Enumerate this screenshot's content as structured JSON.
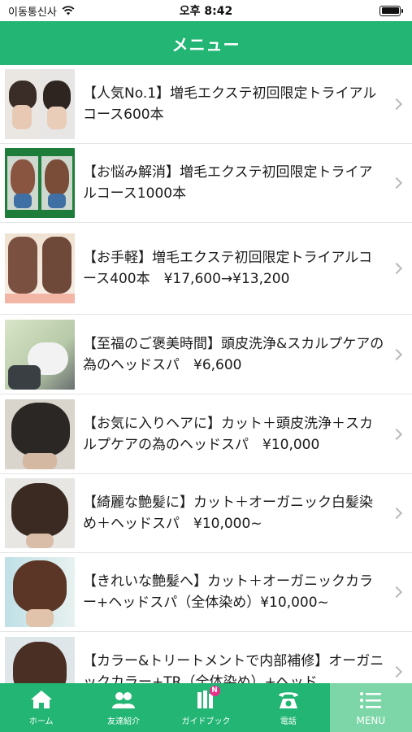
{
  "status": {
    "carrier": "이동통신사",
    "time": "오후 8:42"
  },
  "nav": {
    "title": "メニュー"
  },
  "menu": {
    "items": [
      {
        "text": "【人気No.1】増毛エクステ初回限定トライアルコース600本"
      },
      {
        "text": "【お悩み解消】増毛エクステ初回限定トライアルコース1000本"
      },
      {
        "text": "【お手軽】増毛エクステ初回限定トライアルコース400本　¥17,600→¥13,200"
      },
      {
        "text": "【至福のご褒美時間】頭皮洗浄&スカルプケアの為のヘッドスパ　¥6,600"
      },
      {
        "text": "【お気に入りヘアに】カット＋頭皮洗浄＋スカルプケアの為のヘッドスパ　¥10,000"
      },
      {
        "text": "【綺麗な艶髪に】カット＋オーガニック白髪染め＋ヘッドスパ　¥10,000~"
      },
      {
        "text": "【きれいな艶髪へ】カット＋オーガニックカラー+ヘッドスパ（全体染め）¥10,000~"
      },
      {
        "text": "【カラー&トリートメントで内部補修】オーガニックカラー+TR（全体染め）+ヘッド"
      }
    ]
  },
  "tabs": [
    {
      "label": "ホーム",
      "icon": "home-icon"
    },
    {
      "label": "友達紹介",
      "icon": "friends-icon"
    },
    {
      "label": "ガイドブック",
      "icon": "guidebook-icon",
      "badge": "N"
    },
    {
      "label": "電話",
      "icon": "phone-icon"
    },
    {
      "label": "MENU",
      "icon": "menu-icon",
      "active": true
    }
  ],
  "colors": {
    "brand_green": "#22b573",
    "active_tab": "#7dd6a8"
  }
}
